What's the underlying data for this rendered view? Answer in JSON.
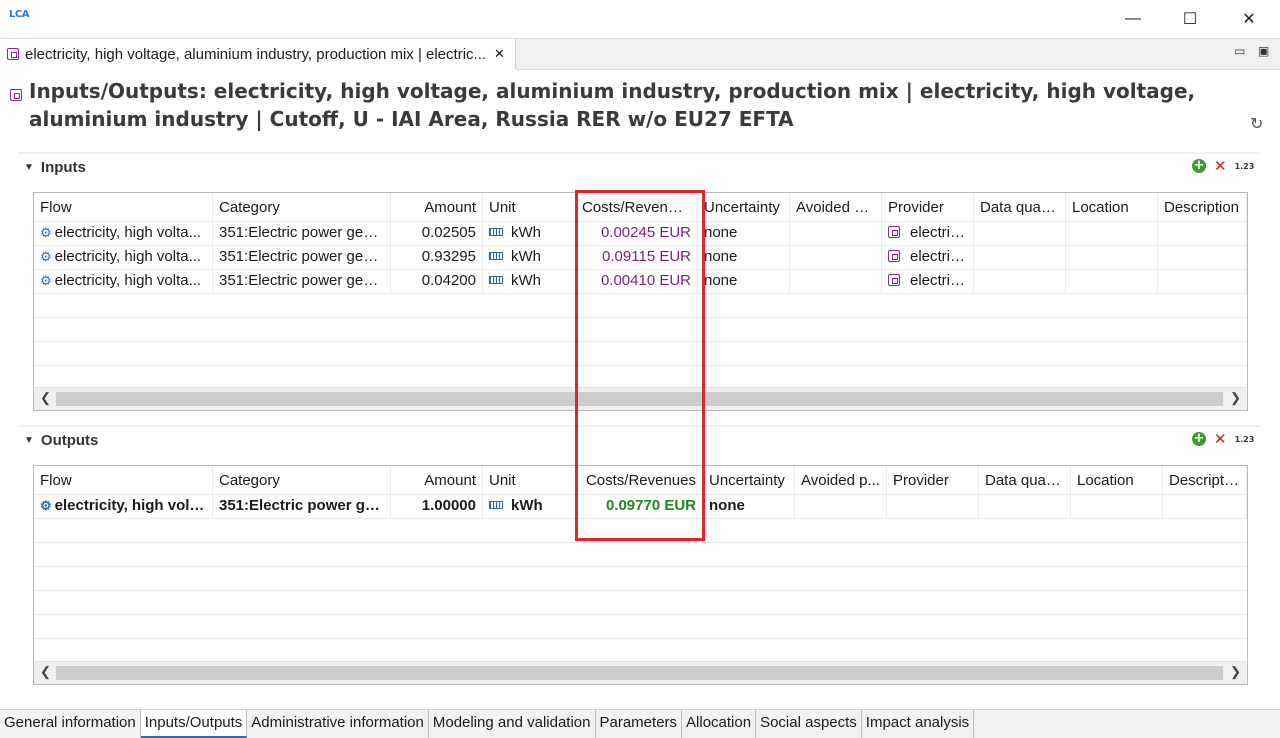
{
  "window": {
    "app_logo": "LCA",
    "minimize": "—",
    "maximize": "☐",
    "close": "✕"
  },
  "editor_tab": {
    "label": "electricity, high voltage, aluminium industry, production mix | electric...",
    "close": "✕"
  },
  "header": {
    "title": "Inputs/Outputs: electricity, high voltage, aluminium industry, production mix | electricity, high voltage, aluminium industry | Cutoff, U - IAI Area, Russia  RER w/o EU27  EFTA"
  },
  "inputs": {
    "title": "Inputs",
    "columns": [
      "Flow",
      "Category",
      "Amount",
      "Unit",
      "Costs/Revenues",
      "Uncertainty",
      "Avoided w...",
      "Provider",
      "Data quali...",
      "Location",
      "Description"
    ],
    "rows": [
      {
        "flow": "electricity, high volta...",
        "category": "351:Electric power gen...",
        "amount": "0.02505",
        "unit": "kWh",
        "cost": "0.00245 EUR",
        "uncertainty": "none",
        "provider": "electric..."
      },
      {
        "flow": "electricity, high volta...",
        "category": "351:Electric power gen...",
        "amount": "0.93295",
        "unit": "kWh",
        "cost": "0.09115 EUR",
        "uncertainty": "none",
        "provider": "electric..."
      },
      {
        "flow": "electricity, high volta...",
        "category": "351:Electric power gen...",
        "amount": "0.04200",
        "unit": "kWh",
        "cost": "0.00410 EUR",
        "uncertainty": "none",
        "provider": "electric..."
      }
    ]
  },
  "outputs": {
    "title": "Outputs",
    "columns": [
      "Flow",
      "Category",
      "Amount",
      "Unit",
      "Costs/Revenues",
      "Uncertainty",
      "Avoided p...",
      "Provider",
      "Data quali...",
      "Location",
      "Description"
    ],
    "rows": [
      {
        "flow": "electricity, high volt...",
        "category": "351:Electric power ge...",
        "amount": "1.00000",
        "unit": "kWh",
        "cost": "0.09770 EUR",
        "uncertainty": "none"
      }
    ]
  },
  "section_actions": {
    "add": "+",
    "remove": "✕",
    "format": "1.23"
  },
  "bottom_tabs": [
    "General information",
    "Inputs/Outputs",
    "Administrative information",
    "Modeling and validation",
    "Parameters",
    "Allocation",
    "Social aspects",
    "Impact analysis"
  ],
  "colors": {
    "cost_input": "#7a1f7a",
    "cost_output": "#1e8a1e",
    "highlight": "#d9282f"
  }
}
